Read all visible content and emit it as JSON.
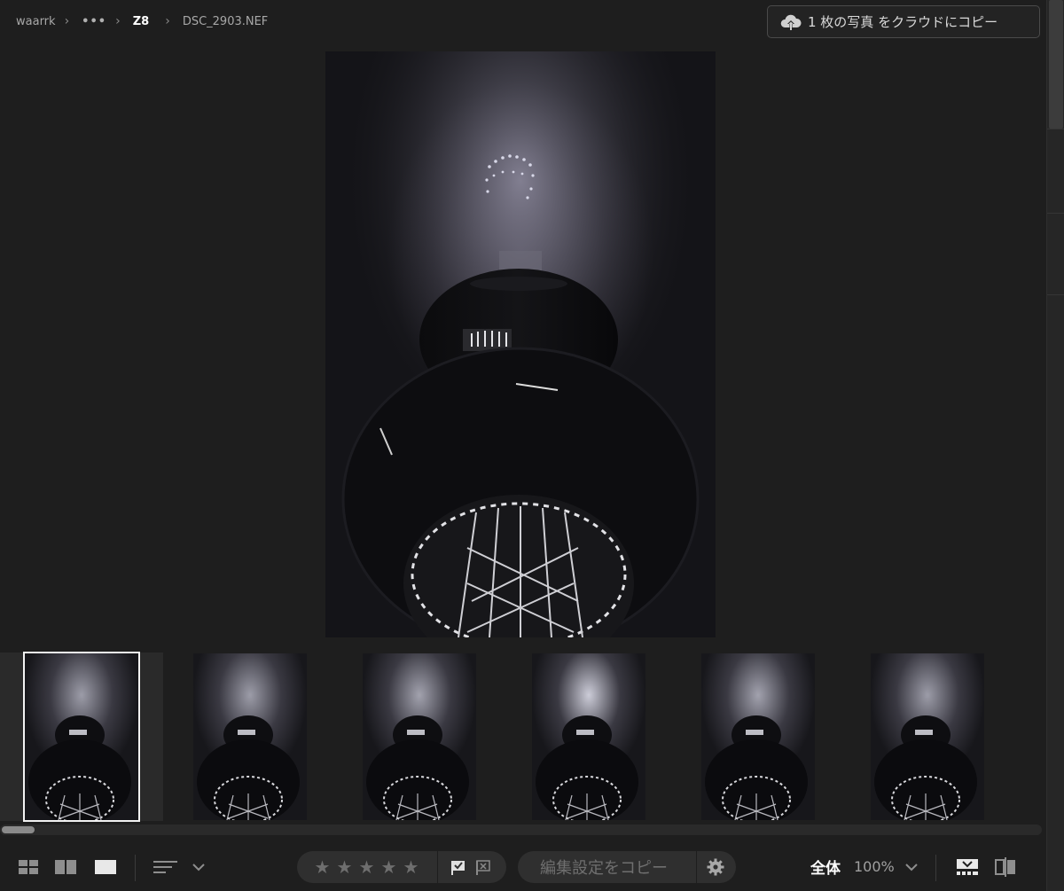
{
  "breadcrumb": {
    "root": "waarrk",
    "ellipsis": "•••",
    "folder": "Z8",
    "file": "DSC_2903.NEF"
  },
  "cloud_copy_button": {
    "label": "1 枚の写真 をクラウドにコピー",
    "icon": "cloud-upload-icon"
  },
  "main_photo": {
    "alt": "DSC_2903.NEF"
  },
  "filmstrip": {
    "selected_index": 0,
    "thumbnails": [
      {
        "id": "thumb-1",
        "glow": 0.55
      },
      {
        "id": "thumb-2",
        "glow": 0.55
      },
      {
        "id": "thumb-3",
        "glow": 0.6
      },
      {
        "id": "thumb-4",
        "glow": 0.95
      },
      {
        "id": "thumb-5",
        "glow": 0.6
      },
      {
        "id": "thumb-6",
        "glow": 0.55
      }
    ]
  },
  "toolbar": {
    "view_icons": [
      "grid-view-icon",
      "compare-view-icon",
      "single-view-icon"
    ],
    "sort_icon": "sort-icon",
    "rating": {
      "max": 5,
      "value": 0,
      "star_glyph": "★"
    },
    "flag_icons": [
      "flag-pick-icon",
      "flag-reject-icon"
    ],
    "copy_edit_label": "編集設定をコピー",
    "settings_icon": "gear-icon",
    "zoom_fit_label": "全体",
    "zoom_value": "100%",
    "right_icons": [
      "filmstrip-toggle-icon",
      "before-after-icon"
    ]
  },
  "colors": {
    "background": "#1e1e1e",
    "toolbar_pill": "#2f2f2f",
    "selected_outline": "#f2f2f2"
  }
}
